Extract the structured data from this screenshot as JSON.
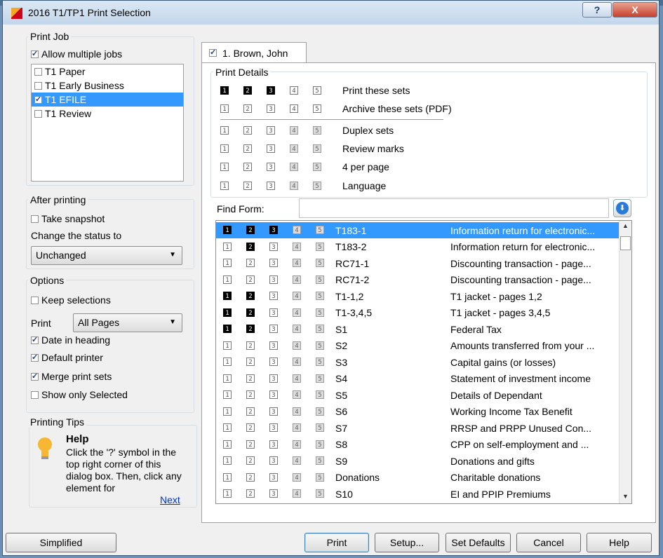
{
  "window": {
    "title": "2016 T1/TP1 Print Selection",
    "help_label": "?",
    "close_label": "X"
  },
  "print_job": {
    "label": "Print Job",
    "allow_multiple": {
      "label": "Allow multiple jobs",
      "checked": true
    },
    "jobs": [
      {
        "label": "T1 Paper",
        "checked": false,
        "selected": false
      },
      {
        "label": "T1 Early Business",
        "checked": false,
        "selected": false
      },
      {
        "label": "T1 EFILE",
        "checked": true,
        "selected": true
      },
      {
        "label": "T1 Review",
        "checked": false,
        "selected": false
      }
    ]
  },
  "after_printing": {
    "label": "After printing",
    "take_snapshot": {
      "label": "Take snapshot",
      "checked": false
    },
    "status_label": "Change the status to",
    "status_value": "Unchanged"
  },
  "options": {
    "label": "Options",
    "keep_selections": {
      "label": "Keep selections",
      "checked": false
    },
    "print_label": "Print",
    "print_value": "All Pages",
    "date_in_heading": {
      "label": "Date in heading",
      "checked": true
    },
    "default_printer": {
      "label": "Default printer",
      "checked": true
    },
    "merge_print_sets": {
      "label": "Merge print sets",
      "checked": true
    },
    "show_only_selected": {
      "label": "Show only Selected",
      "checked": false
    }
  },
  "tips": {
    "label": "Printing Tips",
    "heading": "Help",
    "body": "Click the '?' symbol in the top right corner of this dialog box. Then, click any element for",
    "next": "Next"
  },
  "tab": {
    "label": "1. Brown, John",
    "checked": true
  },
  "print_details": {
    "label": "Print Details",
    "rows": [
      {
        "label": "Print these sets",
        "style": [
          "blk",
          "blk",
          "blk",
          "wht",
          "wht"
        ]
      },
      {
        "label": "Archive these sets (PDF)",
        "style": [
          "wht",
          "wht",
          "wht",
          "wht",
          "wht"
        ]
      },
      {
        "label": "Duplex sets",
        "style": [
          "wht",
          "wht",
          "wht",
          "gry",
          "gry"
        ]
      },
      {
        "label": "Review marks",
        "style": [
          "wht",
          "wht",
          "wht",
          "gry",
          "gry"
        ]
      },
      {
        "label": "4 per page",
        "style": [
          "wht",
          "wht",
          "wht",
          "gry",
          "gry"
        ]
      },
      {
        "label": "Language",
        "style": [
          "wht",
          "wht",
          "wht",
          "gry",
          "gry"
        ]
      }
    ]
  },
  "find_form": {
    "label": "Find Form:",
    "value": ""
  },
  "forms": [
    {
      "code": "T183-1",
      "desc": "Information return for electronic...",
      "style": [
        "blk",
        "blk",
        "blk",
        "gry",
        "gry"
      ],
      "selected": true
    },
    {
      "code": "T183-2",
      "desc": "Information return for electronic...",
      "style": [
        "wht",
        "blk",
        "wht",
        "gry",
        "gry"
      ],
      "selected": false
    },
    {
      "code": "RC71-1",
      "desc": "Discounting transaction - page...",
      "style": [
        "wht",
        "wht",
        "wht",
        "gry",
        "gry"
      ],
      "selected": false
    },
    {
      "code": "RC71-2",
      "desc": "Discounting transaction - page...",
      "style": [
        "wht",
        "wht",
        "wht",
        "gry",
        "gry"
      ],
      "selected": false
    },
    {
      "code": "T1-1,2",
      "desc": "T1 jacket - pages 1,2",
      "style": [
        "blk",
        "blk",
        "wht",
        "gry",
        "gry"
      ],
      "selected": false
    },
    {
      "code": "T1-3,4,5",
      "desc": "T1 jacket - pages 3,4,5",
      "style": [
        "blk",
        "blk",
        "wht",
        "gry",
        "gry"
      ],
      "selected": false
    },
    {
      "code": "S1",
      "desc": "Federal Tax",
      "style": [
        "blk",
        "blk",
        "wht",
        "gry",
        "gry"
      ],
      "selected": false
    },
    {
      "code": "S2",
      "desc": "Amounts transferred from your ...",
      "style": [
        "wht",
        "wht",
        "wht",
        "gry",
        "gry"
      ],
      "selected": false
    },
    {
      "code": "S3",
      "desc": "Capital gains (or losses)",
      "style": [
        "wht",
        "wht",
        "wht",
        "gry",
        "gry"
      ],
      "selected": false
    },
    {
      "code": "S4",
      "desc": "Statement of investment income",
      "style": [
        "wht",
        "wht",
        "wht",
        "gry",
        "gry"
      ],
      "selected": false
    },
    {
      "code": "S5",
      "desc": "Details of Dependant",
      "style": [
        "wht",
        "wht",
        "wht",
        "gry",
        "gry"
      ],
      "selected": false
    },
    {
      "code": "S6",
      "desc": "Working Income Tax Benefit",
      "style": [
        "wht",
        "wht",
        "wht",
        "gry",
        "gry"
      ],
      "selected": false
    },
    {
      "code": "S7",
      "desc": "RRSP and PRPP Unused Con...",
      "style": [
        "wht",
        "wht",
        "wht",
        "gry",
        "gry"
      ],
      "selected": false
    },
    {
      "code": "S8",
      "desc": "CPP on self-employment and ...",
      "style": [
        "wht",
        "wht",
        "wht",
        "gry",
        "gry"
      ],
      "selected": false
    },
    {
      "code": "S9",
      "desc": "Donations and gifts",
      "style": [
        "wht",
        "wht",
        "wht",
        "gry",
        "gry"
      ],
      "selected": false
    },
    {
      "code": "Donations",
      "desc": "Charitable donations",
      "style": [
        "wht",
        "wht",
        "wht",
        "gry",
        "gry"
      ],
      "selected": false
    },
    {
      "code": "S10",
      "desc": "EI and PPIP Premiums",
      "style": [
        "wht",
        "wht",
        "wht",
        "gry",
        "gry"
      ],
      "selected": false
    }
  ],
  "buttons": {
    "simplified": "Simplified",
    "print": "Print",
    "setup": "Setup...",
    "set_defaults": "Set Defaults",
    "cancel": "Cancel",
    "help": "Help"
  }
}
